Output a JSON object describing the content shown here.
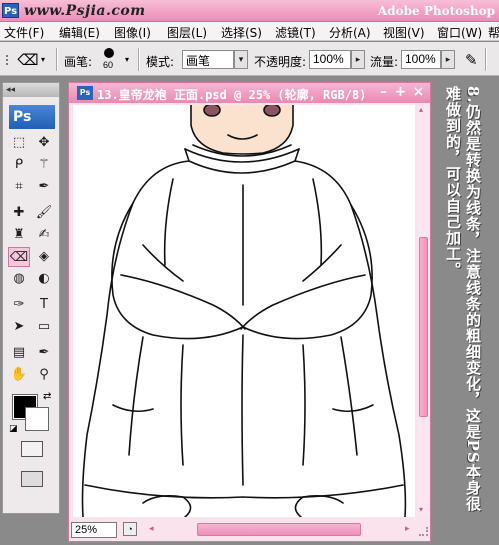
{
  "titlebar": {
    "ps_badge": "Ps",
    "watermark": "www.Psjia.com",
    "app_title": "Adobe Photoshop"
  },
  "menu": [
    "文件(F)",
    "编辑(E)",
    "图像(I)",
    "图层(L)",
    "选择(S)",
    "滤镜(T)",
    "分析(A)",
    "视图(V)",
    "窗口(W)",
    "帮"
  ],
  "options": {
    "brush_label": "画笔:",
    "brush_size": "60",
    "mode_label": "模式:",
    "mode_value": "画笔",
    "opacity_label": "不透明度:",
    "opacity_value": "100%",
    "flow_label": "流量:",
    "flow_value": "100%"
  },
  "toolbox": {
    "header": "◂◂",
    "logo": "Ps"
  },
  "document": {
    "icon": "Ps",
    "title": "13.皇帝龙袍 正面.psd @ 25% (轮廓, RGB/8)",
    "zoom": "25%"
  },
  "caption": {
    "col1": "8.仍然是转换为线条，注意线条的粗细变化，这是PS本身很",
    "col2": "难做到的，可以自己加工。"
  },
  "colors": {
    "accent": "#ec8db5",
    "foreground": "#000000",
    "background": "#ffffff"
  },
  "icons": [
    "photoshop-icon",
    "eraser-icon",
    "brush-preset-icon",
    "airbrush-icon",
    "marquee-icon",
    "move-icon",
    "lasso-icon",
    "magic-wand-icon",
    "crop-icon",
    "eyedropper-icon",
    "healing-brush-icon",
    "brush-icon",
    "clone-stamp-icon",
    "history-brush-icon",
    "eraser-icon",
    "paint-bucket-icon",
    "blur-icon",
    "dodge-icon",
    "pen-icon",
    "type-icon",
    "path-selection-icon",
    "rectangle-icon",
    "notes-icon",
    "eyedropper-icon",
    "hand-icon",
    "zoom-icon"
  ]
}
